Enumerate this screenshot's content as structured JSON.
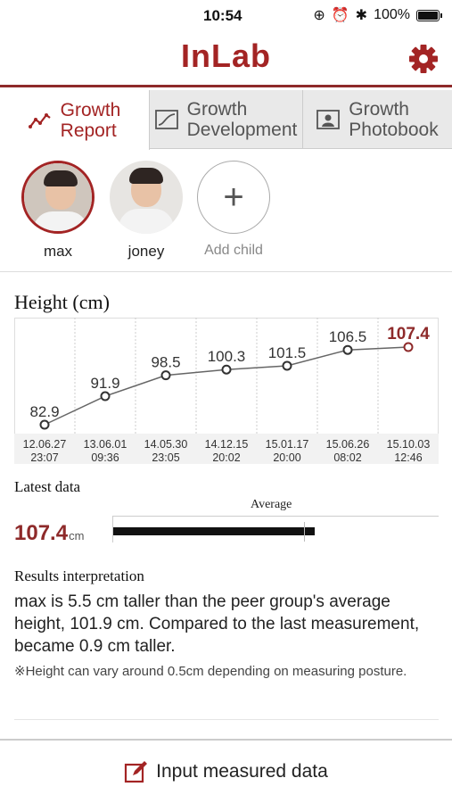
{
  "status_bar": {
    "time": "10:54",
    "battery": "100%"
  },
  "header": {
    "app_name": "InLab",
    "settings_icon": "gear-icon"
  },
  "tabs": [
    {
      "line1": "Growth",
      "line2": "Report",
      "icon": "chart-line-icon",
      "active": true
    },
    {
      "line1": "Growth",
      "line2": "Development",
      "icon": "growth-curve-icon",
      "active": false
    },
    {
      "line1": "Growth",
      "line2": "Photobook",
      "icon": "photo-portrait-icon",
      "active": false
    }
  ],
  "children": [
    {
      "name": "max",
      "selected": true
    },
    {
      "name": "joney",
      "selected": false
    }
  ],
  "add_child": {
    "label": "Add child",
    "icon": "plus-icon"
  },
  "chart": {
    "title": "Height (cm)"
  },
  "chart_data": {
    "type": "line",
    "title": "Height (cm)",
    "x": [
      [
        "12.06.27",
        "23:07"
      ],
      [
        "13.06.01",
        "09:36"
      ],
      [
        "14.05.30",
        "23:05"
      ],
      [
        "14.12.15",
        "20:02"
      ],
      [
        "15.01.17",
        "20:00"
      ],
      [
        "15.06.26",
        "08:02"
      ],
      [
        "15.10.03",
        "12:46"
      ]
    ],
    "series": [
      {
        "values": [
          82.9,
          91.9,
          98.5,
          100.3,
          101.5,
          106.5,
          107.4
        ]
      }
    ],
    "value_labels": [
      "82.9",
      "91.9",
      "98.5",
      "100.3",
      "101.5",
      "106.5",
      "107.4"
    ],
    "highlight_last": true,
    "line_color": "#666666",
    "highlight_color": "#8e2a2a",
    "grid": true
  },
  "latest": {
    "title": "Latest data",
    "value": "107.4",
    "unit": "cm",
    "average_label": "Average",
    "average_value": 101.9,
    "current_value": 107.4
  },
  "results": {
    "title": "Results interpretation",
    "text": "max is 5.5 cm taller than the peer group's average height, 101.9 cm. Compared to the last measurement, became 0.9 cm taller.",
    "note": "※Height can vary around 0.5cm depending on measuring posture."
  },
  "bottom": {
    "label": "Input measured data",
    "icon": "edit-pencil-icon"
  },
  "colors": {
    "accent": "#a32424",
    "accent_dark": "#8e2a2a",
    "tab_bg": "#e9e9e9"
  }
}
